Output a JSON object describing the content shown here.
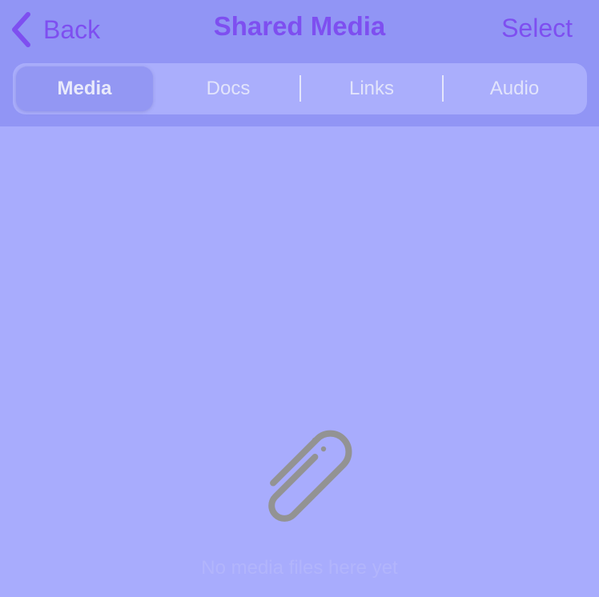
{
  "nav": {
    "back_label": "Back",
    "title": "Shared Media",
    "select_label": "Select"
  },
  "tabs": [
    {
      "label": "Media",
      "active": true
    },
    {
      "label": "Docs",
      "active": false
    },
    {
      "label": "Links",
      "active": false
    },
    {
      "label": "Audio",
      "active": false
    }
  ],
  "empty_state": {
    "icon": "paperclip-icon",
    "text": "No media files here yet"
  },
  "colors": {
    "accent": "#7e4ff0",
    "header_background": "#9195f5",
    "content_background": "#a8acfd",
    "icon": "#939393"
  }
}
